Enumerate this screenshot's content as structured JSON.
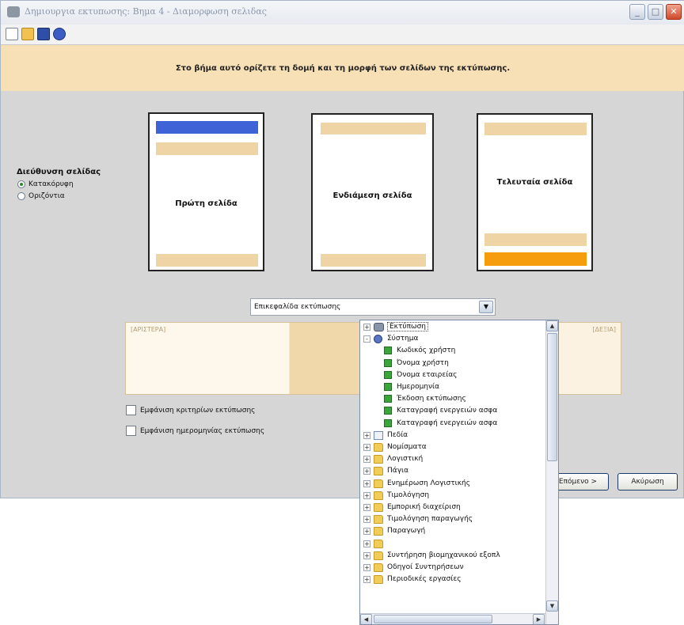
{
  "window": {
    "title": "Δημιουργια εκτυπωσης: Βημα 4 - Διαμορφωση σελιδας",
    "controls": [
      "minimize",
      "maximize",
      "close"
    ]
  },
  "toolbar": {
    "icons": [
      "new-file-icon",
      "open-folder-icon",
      "save-icon",
      "settings-icon"
    ]
  },
  "banner": {
    "text": "Στο βήμα αυτό ορίζετε τη δομή και τη μορφή των σελίδων της εκτύπωσης."
  },
  "pages": {
    "first": "Πρώτη σελίδα",
    "middle": "Ενδιάμεση σελίδα",
    "last": "Τελευταία σελίδα"
  },
  "orientation": {
    "title": "Διεύθυνση σελίδας",
    "options": [
      {
        "label": "Κατακόρυφη",
        "selected": true
      },
      {
        "label": "Οριζόντια",
        "selected": false
      }
    ]
  },
  "header_select": {
    "value": "Επικεφαλίδα εκτύπωσης"
  },
  "header_preview": {
    "left": "[ΑΡΙΣΤΕΡΑ]",
    "right": "[ΔΕΞΙΑ]"
  },
  "checkboxes": [
    {
      "label": "Εμφάνιση κριτηρίων εκτύπωσης",
      "checked": false
    },
    {
      "label": "Εμφάνιση ημερομηνίας εκτύπωσης",
      "checked": false
    }
  ],
  "buttons": {
    "next": "Επόμενο >",
    "cancel": "Ακύρωση"
  },
  "tree": {
    "items": [
      {
        "label": "Εκτύπωση",
        "icon": "printer",
        "level": 0,
        "expander": "+"
      },
      {
        "label": "Σύστημα",
        "icon": "gear",
        "level": 0,
        "expander": "-"
      },
      {
        "label": "Κωδικός χρήστη",
        "icon": "field",
        "level": 1
      },
      {
        "label": "Όνομα χρήστη",
        "icon": "field",
        "level": 1
      },
      {
        "label": "Όνομα εταιρείας",
        "icon": "field",
        "level": 1
      },
      {
        "label": "Ημερομηνία",
        "icon": "field",
        "level": 1
      },
      {
        "label": "Έκδοση εκτύπωσης",
        "icon": "field",
        "level": 1
      },
      {
        "label": "Καταγραφή ενεργειών ασφα",
        "icon": "field",
        "level": 1
      },
      {
        "label": "Καταγραφή ενεργειών ασφα",
        "icon": "field",
        "level": 1
      },
      {
        "label": "Πεδία",
        "icon": "grid",
        "level": 0,
        "expander": "+"
      },
      {
        "label": "Νομίσματα",
        "icon": "folder",
        "level": 0,
        "expander": "+"
      },
      {
        "label": "Λογιστική",
        "icon": "folder",
        "level": 0,
        "expander": "+"
      },
      {
        "label": "Πάγια",
        "icon": "folder",
        "level": 0,
        "expander": "+"
      },
      {
        "label": "Ενημέρωση Λογιστικής",
        "icon": "folder",
        "level": 0,
        "expander": "+"
      },
      {
        "label": "Τιμολόγηση",
        "icon": "folder",
        "level": 0,
        "expander": "+"
      },
      {
        "label": "Εμπορική διαχείριση",
        "icon": "folder",
        "level": 0,
        "expander": "+"
      },
      {
        "label": "Τιμολόγηση παραγωγής",
        "icon": "folder",
        "level": 0,
        "expander": "+"
      },
      {
        "label": "Παραγωγή",
        "icon": "folder",
        "level": 0,
        "expander": "+"
      },
      {
        "label": "",
        "icon": "folder",
        "level": 0,
        "expander": "+"
      },
      {
        "label": "Συντήρηση βιομηχανικού εξοπλ",
        "icon": "folder",
        "level": 0,
        "expander": "+"
      },
      {
        "label": "Οδηγοί Συντηρήσεων",
        "icon": "folder",
        "level": 0,
        "expander": "+"
      },
      {
        "label": "Περιοδικές εργασίες",
        "icon": "folder",
        "level": 0,
        "expander": "+"
      }
    ]
  },
  "colors": {
    "banner": "#f7dfb6",
    "accent_blue": "#3e63d6",
    "accent_orange": "#f59d0c",
    "sand": "#efd5a6"
  }
}
